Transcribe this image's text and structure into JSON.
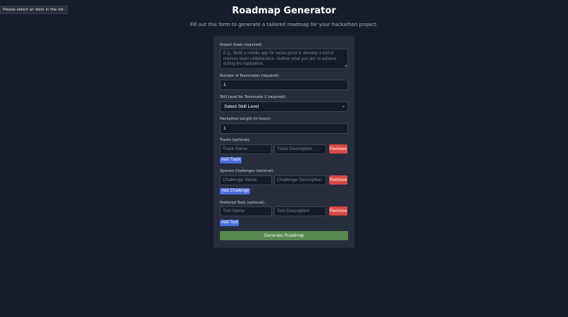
{
  "tooltip": "Please select an item in the list.",
  "page": {
    "title": "Roadmap Generator",
    "subtitle": "Fill out this form to generate a tailored roadmap for your hackathon project."
  },
  "form": {
    "goals_label": "Project Goals (required):",
    "goals_placeholder": "E.g., Build a mobile app for social good or develop a tool to improve team collaboration. Outline what you aim to achieve during the hackathon.",
    "teammates_label": "Number of Teammates (required):",
    "teammates_value": "1",
    "skill_label": "Skill Level for Teammate 1 (required):",
    "skill_value": "Select Skill Level",
    "length_label": "Hackathon Length (in hours):",
    "length_value": "1",
    "tracks_label": "Tracks (optional):",
    "track_name_placeholder": "Track Name",
    "track_desc_placeholder": "Track Description",
    "add_track": "Add Track",
    "challenges_label": "Sponsor Challenges (optional):",
    "challenge_name_placeholder": "Challenge Name",
    "challenge_desc_placeholder": "Challenge Description",
    "add_challenge": "Add Challenge",
    "tools_label": "Preferred Tools (optional):",
    "tool_name_placeholder": "Tool Name",
    "tool_desc_placeholder": "Tool Description",
    "add_tool": "Add Tool",
    "remove": "Remove",
    "generate": "Generate Roadmap"
  },
  "icons": {
    "select_chevron": "chevron-down-icon",
    "resize_handle": "resize-handle-icon"
  },
  "colors": {
    "background": "#171c2a",
    "card": "#262d3d",
    "remove": "#d94a44",
    "add": "#4b6de0",
    "generate": "#58894e"
  }
}
